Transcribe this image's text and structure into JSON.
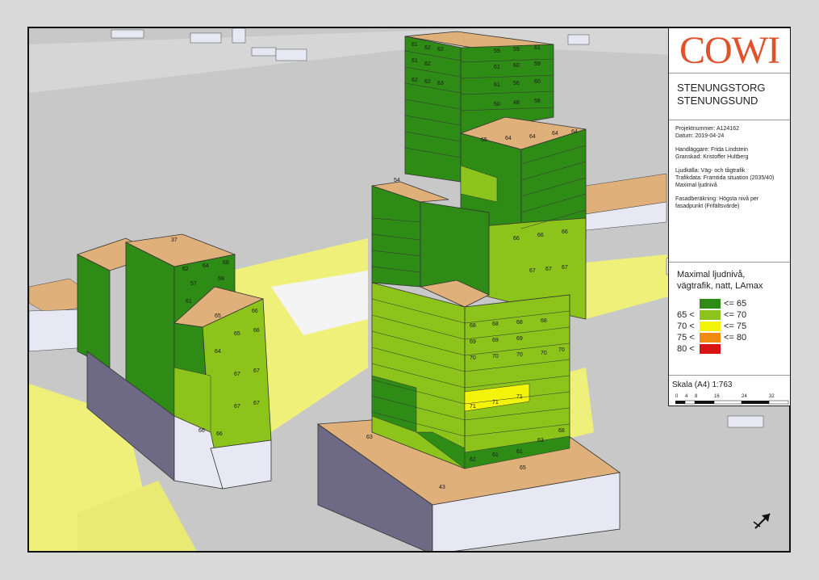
{
  "logo": "COWI",
  "title": [
    "STENUNGSTORG",
    "STENUNGSUND"
  ],
  "project": {
    "projektnummer": "Projektnummer: A124162",
    "datum": "Datum: 2019-04-24",
    "handlaggare": "Handläggare: Frida Lindstein",
    "granskad": "Granskad: Kristoffer Hultberg",
    "ljudkalla": "Ljudkälla: Väg- och tågtrafik",
    "trafikdata": "Trafikdata: Framtida situation (2035/40)",
    "maximal": "Maximal ljudnivå",
    "fasad1": "Fasadberäkning: Högsta nivå per",
    "fasad2": "fasadpunkt (Frifältsvärde)"
  },
  "legend": {
    "title": [
      "Maximal ljudnivå,",
      "vägtrafik, natt, LAmax"
    ],
    "items": [
      {
        "lo": "",
        "hi": "<= 65",
        "color": "#2e8b16"
      },
      {
        "lo": "65 <",
        "hi": "<= 70",
        "color": "#8cc41c"
      },
      {
        "lo": "70 <",
        "hi": "<= 75",
        "color": "#f4f40a"
      },
      {
        "lo": "75 <",
        "hi": "<= 80",
        "color": "#f08a10"
      },
      {
        "lo": "80 <",
        "hi": "",
        "color": "#d81414"
      }
    ]
  },
  "scale": {
    "label": "Skala (A4) 1:763",
    "ticks": [
      "0",
      "4",
      "8",
      "16",
      "24",
      "32"
    ]
  },
  "map_labels": {
    "tower_top": [
      "61",
      "62",
      "62",
      "59",
      "59",
      "61",
      "61",
      "62",
      "62",
      "61",
      "60",
      "59",
      "62",
      "62",
      "63",
      "61",
      "57",
      "56",
      "60",
      "62",
      "61",
      "63",
      "57",
      "50",
      "48",
      "58",
      "61",
      "63",
      "61",
      "56",
      "48"
    ],
    "tower_mid_row1": [
      "65",
      "64",
      "64",
      "64",
      "64"
    ],
    "tower_yellow": [
      "71",
      "71",
      "71"
    ],
    "tower_lower": [
      "70",
      "70",
      "70",
      "70",
      "70",
      "69",
      "69",
      "69",
      "68",
      "68",
      "68",
      "68",
      "67",
      "67",
      "67",
      "66",
      "66",
      "66"
    ],
    "tower_base": [
      "62",
      "61",
      "61",
      "63",
      "68"
    ],
    "left_building": [
      "62",
      "64",
      "68",
      "57",
      "59",
      "61",
      "65",
      "66",
      "65",
      "64",
      "66",
      "67",
      "67",
      "67",
      "67",
      "66",
      "66"
    ],
    "ground": [
      "63",
      "65",
      "43",
      "37",
      "54"
    ]
  },
  "colors": {
    "ground_gray": "#c8c8c8",
    "road_yellow": "#f2f28a",
    "roof_tan": "#e0b07a",
    "facade_dark": "#2e8b16",
    "facade_light": "#8cc41c",
    "facade_yellow": "#f4f40a",
    "wall_lavender": "#e8e8f4",
    "wall_shadow": "#6e6a86"
  }
}
